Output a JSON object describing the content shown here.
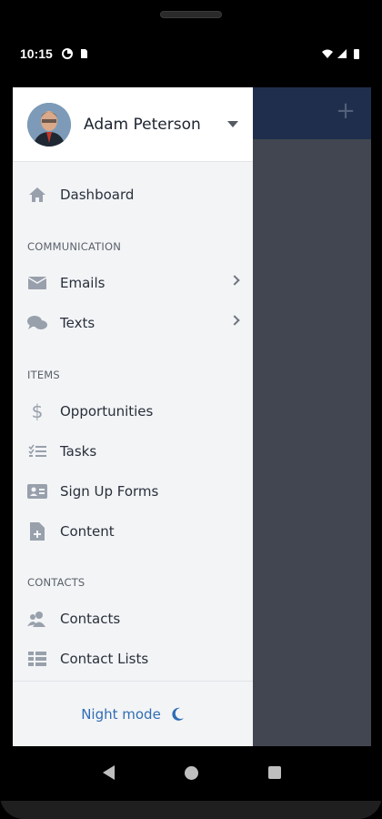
{
  "status_bar": {
    "time": "10:15",
    "left_icons": [
      "data-saver-icon",
      "sim-card-icon"
    ],
    "right_icons": [
      "wifi-icon",
      "signal-icon",
      "battery-icon"
    ]
  },
  "drawer": {
    "user": {
      "name": "Adam Peterson"
    },
    "items": [
      {
        "label": "Dashboard",
        "icon": "home-icon"
      }
    ],
    "sections": [
      {
        "title": "COMMUNICATION",
        "items": [
          {
            "label": "Emails",
            "icon": "envelope-icon",
            "has_submenu": true
          },
          {
            "label": "Texts",
            "icon": "chat-bubbles-icon",
            "has_submenu": true
          }
        ]
      },
      {
        "title": "ITEMS",
        "items": [
          {
            "label": "Opportunities",
            "icon": "dollar-icon"
          },
          {
            "label": "Tasks",
            "icon": "checklist-icon"
          },
          {
            "label": "Sign Up Forms",
            "icon": "id-card-icon"
          },
          {
            "label": "Content",
            "icon": "document-plus-icon"
          }
        ]
      },
      {
        "title": "CONTACTS",
        "items": [
          {
            "label": "Contacts",
            "icon": "people-icon"
          },
          {
            "label": "Contact Lists",
            "icon": "list-icon"
          }
        ]
      }
    ],
    "footer": {
      "label": "Night mode",
      "icon": "moon-icon"
    }
  },
  "app_bar": {
    "plus_icon": "plus-icon",
    "accent": "#1f2e4d"
  },
  "colors": {
    "accent_link": "#2f6db5",
    "icon_gray": "#98a0ab",
    "drawer_bg": "#f3f4f6",
    "scrim": "#424650"
  }
}
